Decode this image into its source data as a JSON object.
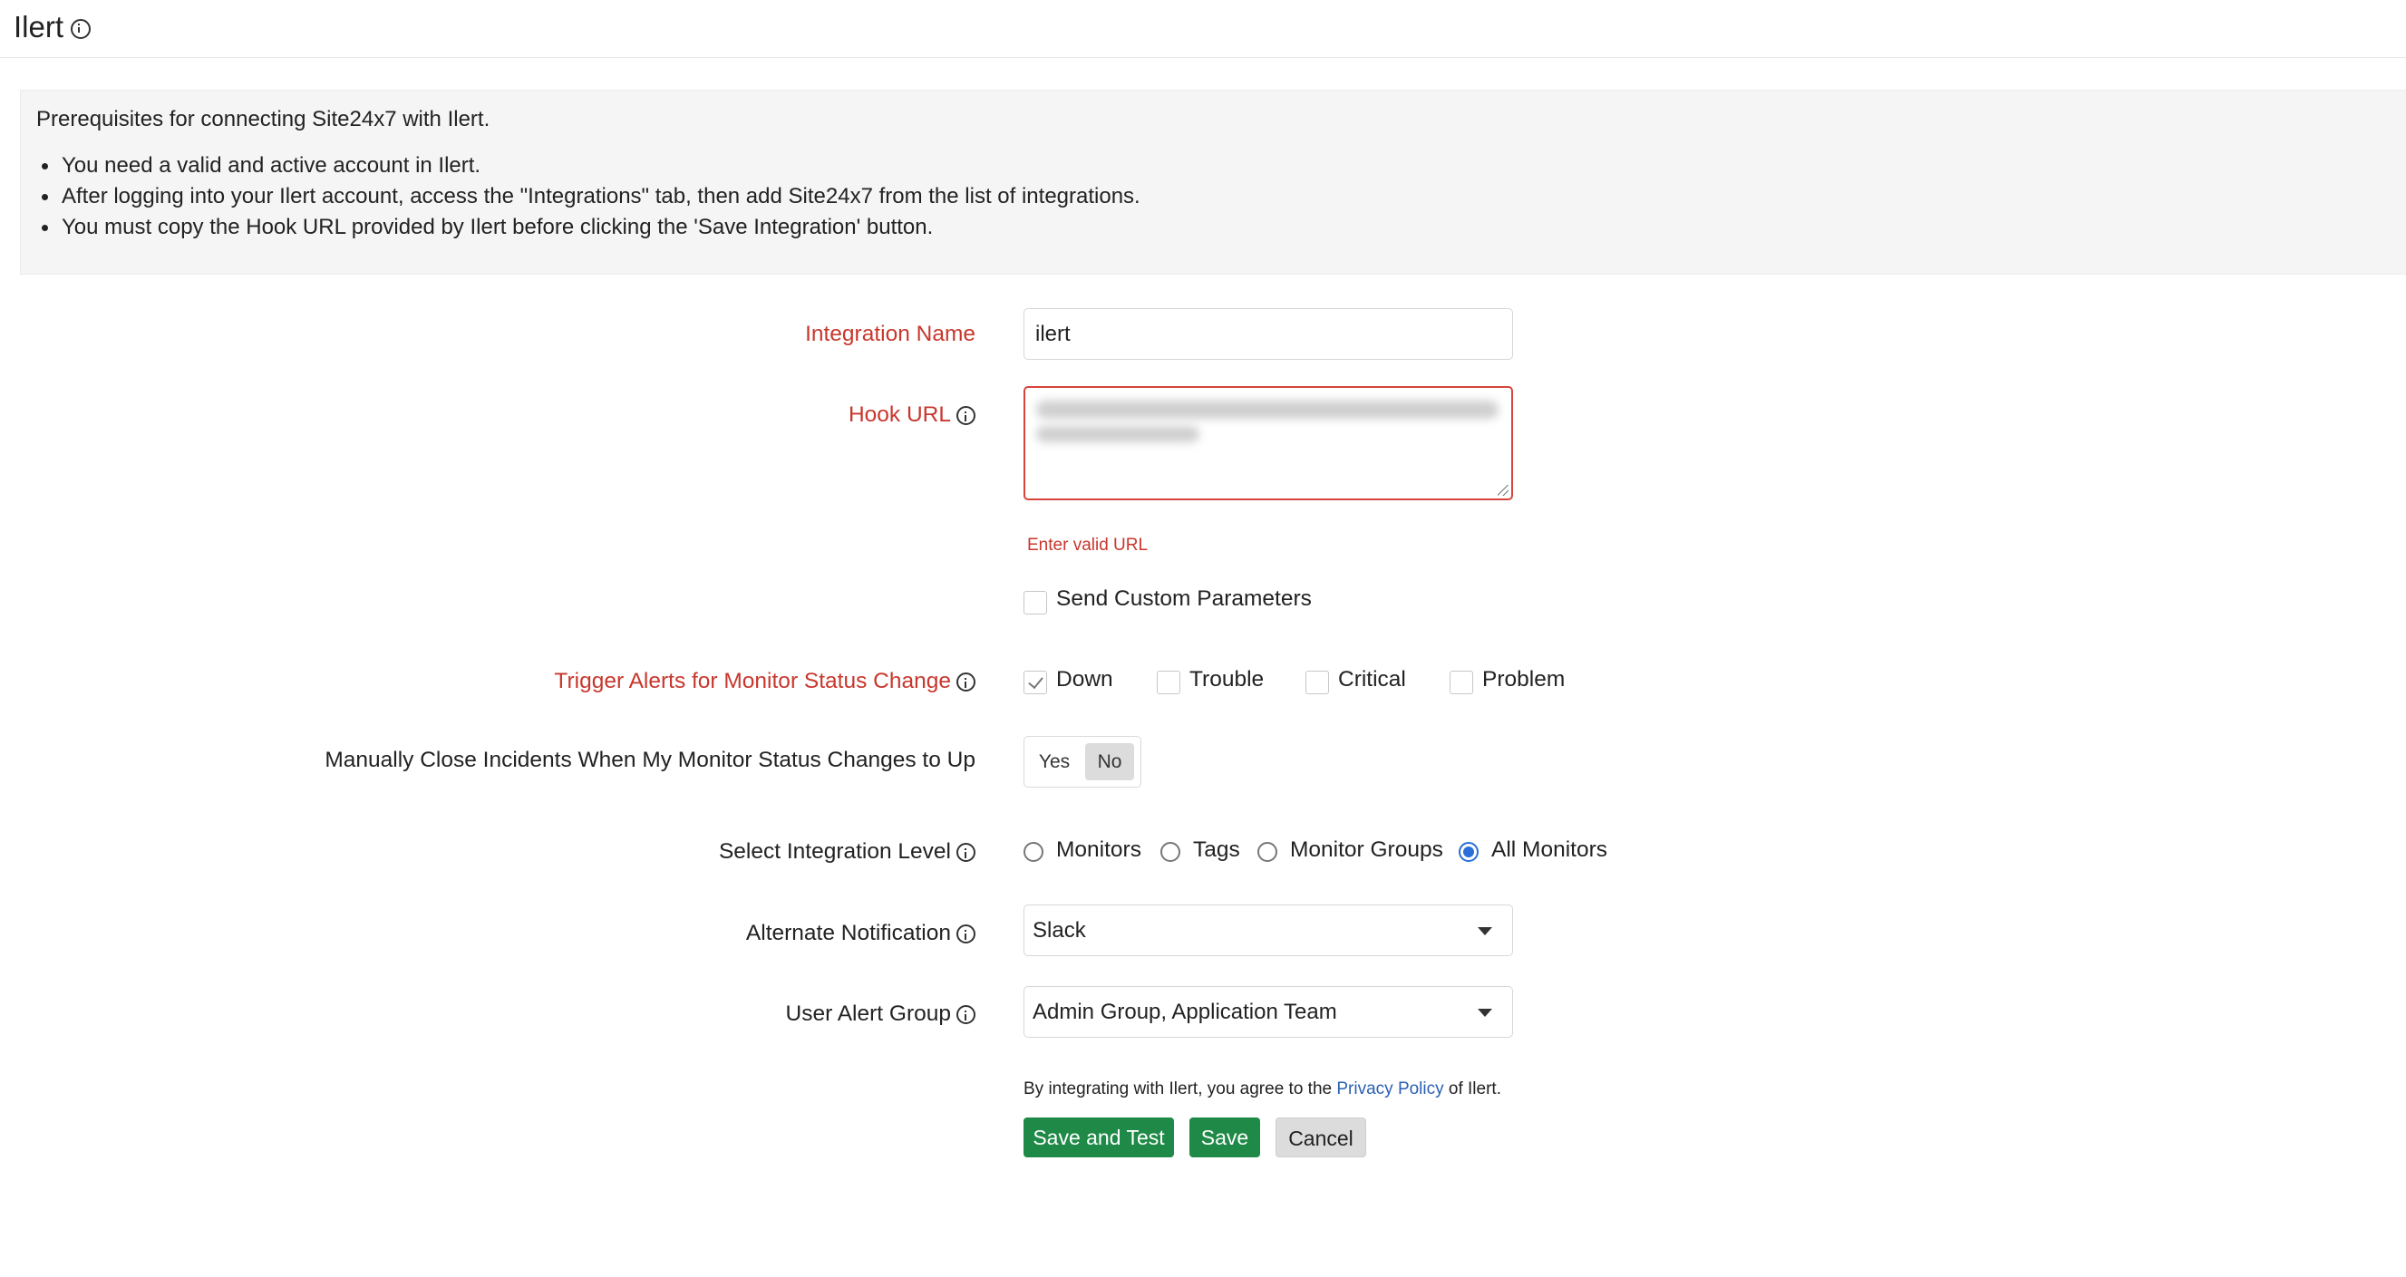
{
  "header": {
    "title": "Ilert"
  },
  "prerequisites": {
    "title": "Prerequisites for connecting Site24x7 with Ilert.",
    "items": [
      "You need a valid and active account in Ilert.",
      "After logging into your Ilert account, access the \"Integrations\" tab, then add Site24x7 from the list of integrations.",
      "You must copy the Hook URL provided by Ilert before clicking the 'Save Integration' button."
    ]
  },
  "form": {
    "integration_name": {
      "label": "Integration Name",
      "value": "ilert"
    },
    "hook_url": {
      "label": "Hook URL",
      "error": "Enter valid URL"
    },
    "custom_params": {
      "label": "Send Custom Parameters",
      "checked": false
    },
    "trigger_alerts": {
      "label": "Trigger Alerts for Monitor Status Change",
      "options": [
        {
          "label": "Down",
          "checked": true
        },
        {
          "label": "Trouble",
          "checked": false
        },
        {
          "label": "Critical",
          "checked": false
        },
        {
          "label": "Problem",
          "checked": false
        }
      ]
    },
    "manual_close": {
      "label": "Manually Close Incidents When My Monitor Status Changes to Up",
      "yes": "Yes",
      "no": "No",
      "selected": "No"
    },
    "integration_level": {
      "label": "Select Integration Level",
      "options": [
        "Monitors",
        "Tags",
        "Monitor Groups",
        "All Monitors"
      ],
      "selected": "All Monitors"
    },
    "alternate_notification": {
      "label": "Alternate Notification",
      "value": "Slack"
    },
    "user_alert_group": {
      "label": "User Alert Group",
      "value": "Admin Group, Application Team"
    }
  },
  "footer": {
    "agree_prefix": "By integrating with Ilert, you agree to the",
    "privacy_link": "Privacy Policy",
    "agree_suffix": "of Ilert.",
    "buttons": {
      "save_and_test": "Save and Test",
      "save": "Save",
      "cancel": "Cancel"
    }
  },
  "colors": {
    "required_label": "#c8372d",
    "primary_button": "#1f8a47",
    "radio_selected": "#2b6ed9",
    "link": "#2b5fb3"
  }
}
